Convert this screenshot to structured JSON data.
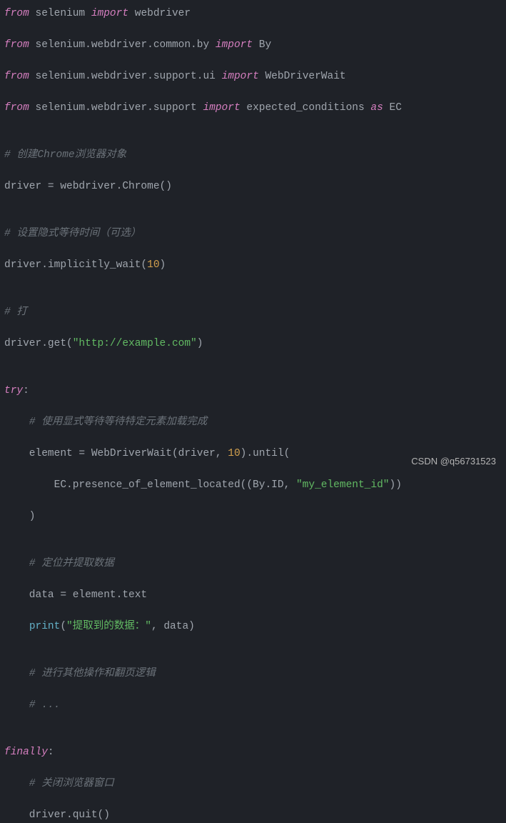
{
  "code": {
    "l1_from": "from",
    "l1_mod": " selenium ",
    "l1_import": "import",
    "l1_rest": " webdriver",
    "l2_from": "from",
    "l2_mod": " selenium.webdriver.common.by ",
    "l2_import": "import",
    "l2_rest": " By",
    "l3_from": "from",
    "l3_mod": " selenium.webdriver.support.ui ",
    "l3_import": "import",
    "l3_rest": " WebDriverWait",
    "l4_from": "from",
    "l4_mod": " selenium.webdriver.support ",
    "l4_import": "import",
    "l4_rest1": " expected_conditions ",
    "l4_as": "as",
    "l4_rest2": " EC",
    "c1": "# 创建Chrome浏览器对象",
    "l6a": "driver = webdriver.Chrome()",
    "c2": "# 设置隐式等待时间（可选）",
    "l8a": "driver.implicitly_wait(",
    "l8num": "10",
    "l8b": ")",
    "c3": "# 打",
    "l10a": "driver.get(",
    "l10str": "\"http://example.com\"",
    "l10b": ")",
    "l12try": "try",
    "l12colon": ":",
    "c4": "    # 使用显式等待等待特定元素加载完成",
    "l13a": "    element = WebDriverWait(driver, ",
    "l13num": "10",
    "l13b": ").until(",
    "l14a": "        EC.presence_of_element_located((By.ID, ",
    "l14str": "\"my_element_id\"",
    "l14b": "))",
    "l15": "    )",
    "c5": "    # 定位并提取数据",
    "l17": "    data = element.text",
    "l18a": "    ",
    "l18fn": "print",
    "l18b": "(",
    "l18str": "\"提取到的数据：\"",
    "l18c": ", data)",
    "c6": "    # 进行其他操作和翻页逻辑",
    "c7": "    # ...",
    "l21fin": "finally",
    "l21colon": ":",
    "c8": "    # 关闭浏览器窗口",
    "l22": "    driver.quit()"
  },
  "watermark": "CSDN @q56731523"
}
